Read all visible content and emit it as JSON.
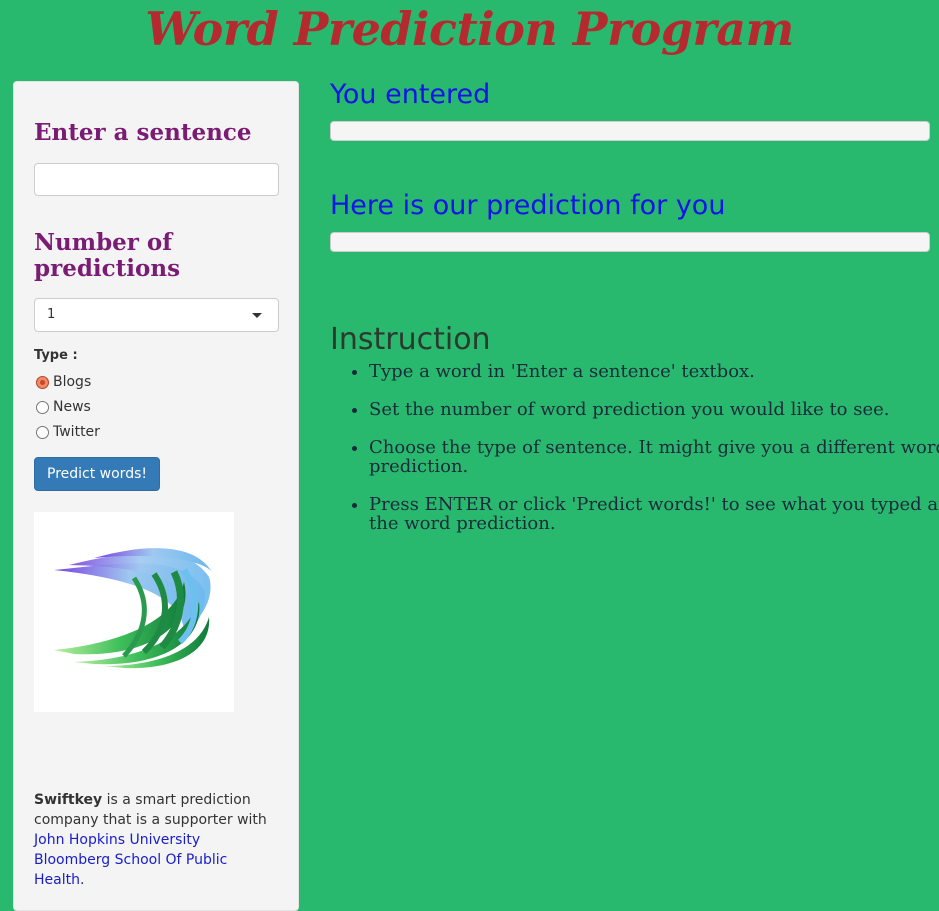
{
  "app": {
    "title": "Word Prediction Program"
  },
  "sidebar": {
    "sentence_heading": "Enter a sentence",
    "sentence_input": {
      "value": "",
      "placeholder": ""
    },
    "num_heading": "Number of predictions",
    "num_select": {
      "selected": "1"
    },
    "type_label": "Type :",
    "type_options": [
      {
        "label": "Blogs",
        "checked": true
      },
      {
        "label": "News",
        "checked": false
      },
      {
        "label": "Twitter",
        "checked": false
      }
    ],
    "predict_button": "Predict words!",
    "logo_icon": "swiftkey-logo",
    "about": {
      "brand": "Swiftkey",
      "text": " is a smart prediction company that is a supporter with ",
      "link": "John Hopkins University Bloomberg School Of Public Health."
    }
  },
  "main": {
    "entered_heading": "You entered",
    "entered_value": "",
    "prediction_heading": "Here is our prediction for you",
    "prediction_value": "",
    "instruction_heading": "Instruction",
    "instructions": [
      "Type a word in 'Enter a sentence' textbox.",
      "Set the number of word prediction you would like to see.",
      "Choose the type of sentence. It might give you a different word prediction.",
      "Press ENTER or click 'Predict words!' to see what you typed and the word prediction."
    ]
  },
  "colors": {
    "background": "#28b96f",
    "title": "#b52a2f",
    "sidebar_heading": "#7b1c74",
    "main_heading": "#1414e6",
    "button": "#337ab7",
    "link": "#1a20c8"
  }
}
